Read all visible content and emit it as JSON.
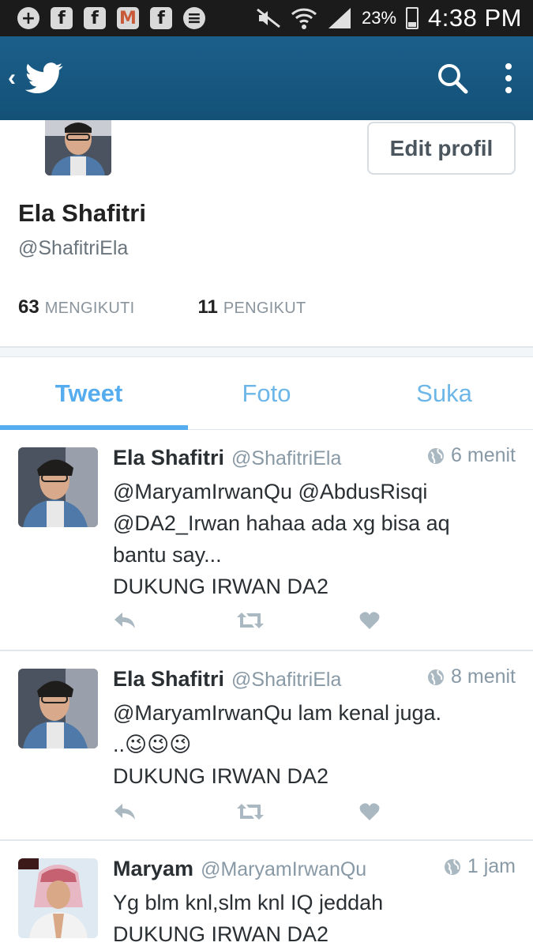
{
  "status_bar": {
    "notification_icons": [
      "plus-icon",
      "facebook-icon",
      "facebook-icon",
      "gmail-icon",
      "facebook-icon",
      "messenger-icon"
    ],
    "battery_percent": "23%",
    "time": "4:38 PM",
    "colors": {
      "background": "#1b1b1b"
    }
  },
  "app_bar": {
    "back_icon": "chevron-left-icon",
    "logo_icon": "twitter-bird-icon",
    "search_icon": "search-icon",
    "menu_icon": "more-vertical-icon",
    "colors": {
      "background": "#1c5f8b"
    }
  },
  "profile": {
    "name": "Ela Shafitri",
    "handle": "@ShafitriEla",
    "edit_button": "Edit profil",
    "following_count": "63",
    "following_label": "MENGIKUTI",
    "followers_count": "11",
    "followers_label": "PENGIKUT"
  },
  "tabs": [
    {
      "label": "Tweet",
      "active": true
    },
    {
      "label": "Foto",
      "active": false
    },
    {
      "label": "Suka",
      "active": false
    }
  ],
  "tweets": [
    {
      "name": "Ela Shafitri",
      "handle": "@ShafitriEla",
      "time": "6 menit",
      "text": "@MaryamIrwanQu @AbdusRisqi\n@DA2_Irwan hahaa ada xg bisa aq\nbantu say...\nDUKUNG IRWAN DA2"
    },
    {
      "name": "Ela Shafitri",
      "handle": "@ShafitriEla",
      "time": "8 menit",
      "text": "@MaryamIrwanQu lam kenal juga.\n..😉😉😉\nDUKUNG IRWAN DA2"
    },
    {
      "name": "Maryam",
      "handle": "@MaryamIrwanQu",
      "time": "1 jam",
      "text": "Yg blm knl,slm knl IQ jeddah\nDUKUNG IRWAN DA2"
    }
  ],
  "colors": {
    "accent": "#55acee",
    "text": "#292f33",
    "muted": "#8899a6"
  }
}
